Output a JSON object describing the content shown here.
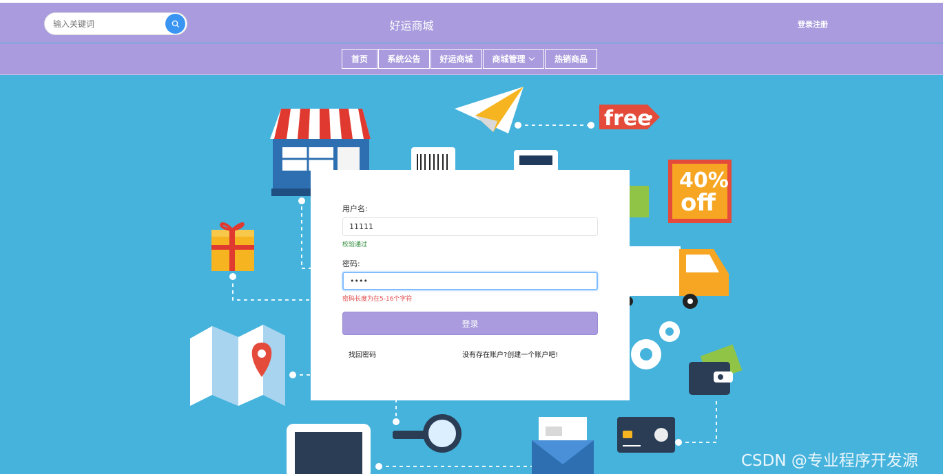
{
  "header": {
    "search_placeholder": "输入关键词",
    "site_title": "好运商城",
    "login_register": "登录注册"
  },
  "nav": [
    {
      "label": "首页"
    },
    {
      "label": "系统公告"
    },
    {
      "label": "好运商城"
    },
    {
      "label": "商城管理"
    },
    {
      "label": "热销商品"
    }
  ],
  "hero": {
    "free_tag": "free",
    "discount_line1": "40%",
    "discount_line2": "off"
  },
  "login": {
    "username_label": "用户名:",
    "username_value": "11111",
    "username_hint": "校验通过",
    "password_label": "密码:",
    "password_value": "••••",
    "password_hint": "密码长度为在5-16个字符",
    "submit_label": "登录",
    "forgot_link": "找回密码",
    "register_link": "没有存在账户?创建一个账户吧!"
  },
  "watermark": "CSDN @专业程序开发源",
  "colors": {
    "header": "#a99bdd",
    "search_button": "#3a95f2",
    "background": "#46b3dd",
    "hint_ok": "#2e8b3a",
    "hint_error": "#e04a4a"
  }
}
